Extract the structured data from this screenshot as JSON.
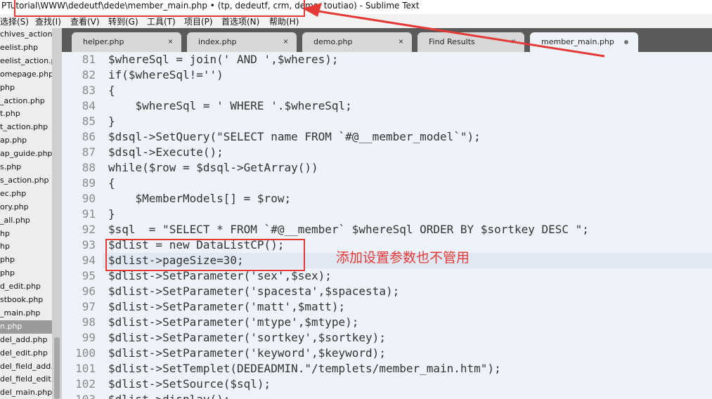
{
  "window": {
    "title": "PTutorial\\WWW\\dedeutf\\dede\\member_main.php • (tp, dedeutf, crm, demo, toutiao) - Sublime Text"
  },
  "menu": [
    "选择(S)",
    "查找(I)",
    "查看(V)",
    "转到(G)",
    "工具(T)",
    "项目(P)",
    "首选项(N)",
    "帮助(H)"
  ],
  "sidebar": {
    "items": [
      "chives_action.",
      "eelist.php",
      "eelist_action.p",
      "omepage.php",
      "php",
      "_action.php",
      "t.php",
      "t_action.php",
      "ap.php",
      "ap_guide.php",
      "s.php",
      "s_action.php",
      "ec.php",
      "ory.php",
      "_all.php",
      "hp",
      "hp",
      "php",
      "php",
      "d_edit.php",
      "stbook.php",
      "_main.php",
      "n.php",
      "del_add.php",
      "del_edit.php",
      "del_field_add.p",
      "del_field_edit.p",
      "del_main.php"
    ],
    "active_index": 22
  },
  "tabs": [
    {
      "label": "helper.php",
      "active": false
    },
    {
      "label": "index.php",
      "active": false
    },
    {
      "label": "demo.php",
      "active": false
    },
    {
      "label": "Find Results",
      "active": false
    },
    {
      "label": "member_main.php",
      "active": true
    }
  ],
  "tab_close_icon": "×",
  "editor": {
    "current_line": 94,
    "lines": [
      {
        "n": "81",
        "code": "$whereSql = join(' AND ',$wheres);"
      },
      {
        "n": "82",
        "code": "if($whereSql!='')"
      },
      {
        "n": "83",
        "code": "{"
      },
      {
        "n": "84",
        "code": "    $whereSql = ' WHERE '.$whereSql;"
      },
      {
        "n": "85",
        "code": "}"
      },
      {
        "n": "86",
        "code": "$dsql->SetQuery(\"SELECT name FROM `#@__member_model`\");"
      },
      {
        "n": "87",
        "code": "$dsql->Execute();"
      },
      {
        "n": "88",
        "code": "while($row = $dsql->GetArray())"
      },
      {
        "n": "89",
        "code": "{"
      },
      {
        "n": "90",
        "code": "    $MemberModels[] = $row;"
      },
      {
        "n": "91",
        "code": "}"
      },
      {
        "n": "92",
        "code": "$sql  = \"SELECT * FROM `#@__member` $whereSql ORDER BY $sortkey DESC \";"
      },
      {
        "n": "93",
        "code": "$dlist = new DataListCP();"
      },
      {
        "n": "94",
        "code": "$dlist->pageSize=30;"
      },
      {
        "n": "95",
        "code": "$dlist->SetParameter('sex',$sex);"
      },
      {
        "n": "96",
        "code": "$dlist->SetParameter('spacesta',$spacesta);"
      },
      {
        "n": "97",
        "code": "$dlist->SetParameter('matt',$matt);"
      },
      {
        "n": "98",
        "code": "$dlist->SetParameter('mtype',$mtype);"
      },
      {
        "n": "99",
        "code": "$dlist->SetParameter('sortkey',$sortkey);"
      },
      {
        "n": "100",
        "code": "$dlist->SetParameter('keyword',$keyword);"
      },
      {
        "n": "101",
        "code": "$dlist->SetTemplet(DEDEADMIN.\"/templets/member_main.htm\");"
      },
      {
        "n": "102",
        "code": "$dlist->SetSource($sql);"
      },
      {
        "n": "103",
        "code": "$dlist->display();"
      }
    ]
  },
  "annotation": {
    "text": "添加设置参数也不管用",
    "color": "#e53935"
  },
  "colors": {
    "highlight": "#e53935",
    "editor_bg": "#eef3f9",
    "tabbar_bg": "#5a5a5a"
  }
}
